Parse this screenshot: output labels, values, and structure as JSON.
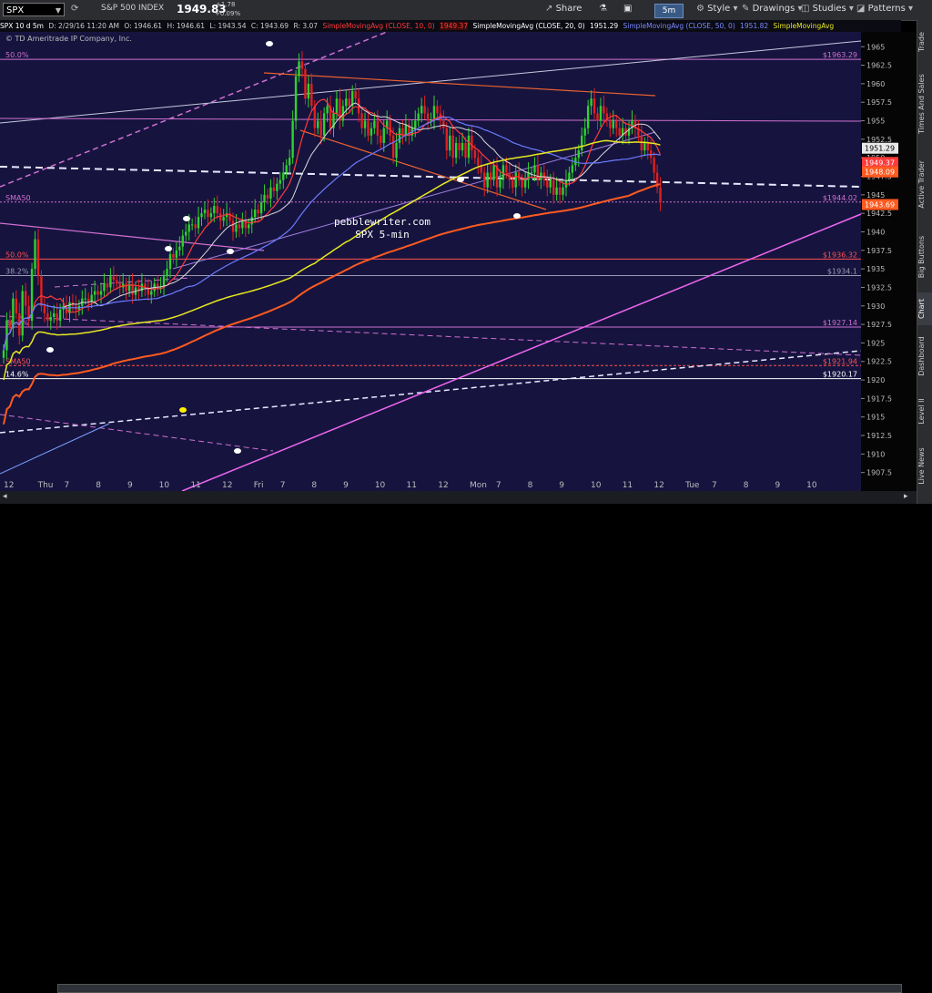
{
  "toolbar": {
    "symbol": "SPX",
    "name": "S&P 500 INDEX",
    "price": "1949.83",
    "change": "+1.78",
    "change_pct": "+0.09%",
    "share": "Share",
    "timeframe": "5m",
    "style": "Style",
    "drawings": "Drawings",
    "studies": "Studies",
    "patterns": "Patterns"
  },
  "info": {
    "desc": "SPX 10 d 5m",
    "date": "D: 2/29/16 11:20 AM",
    "open": "O: 1946.61",
    "high": "H: 1946.61",
    "low": "L: 1943.54",
    "close": "C: 1943.69",
    "range": "R: 3.07",
    "sma10_label": "SimpleMovingAvg (CLOSE, 10, 0)",
    "sma10_val": "1949.37",
    "sma20_label": "SimpleMovingAvg (CLOSE, 20, 0)",
    "sma20_val": "1951.29",
    "sma50_label": "SimpleMovingAvg (CLOSE, 50, 0)",
    "sma50_val": "1951.82",
    "sma_more": "SimpleMovingAvg",
    "copyright": "© TD Ameritrade IP Company, Inc."
  },
  "colors": {
    "bg": "#16143e",
    "up": "#2fd12f",
    "down": "#e02020",
    "sma10": "#ff3a3a",
    "sma20": "#d8d8d8",
    "sma50": "#6a7bff",
    "sma100": "#e8e820",
    "sma200": "#ff5a20",
    "fib": "#d070d0"
  },
  "watermark": {
    "line1": "pebblewriter.com",
    "line2": "SPX 5-min"
  },
  "side_tabs": [
    "Trade",
    "Times And Sales",
    "Active Trader",
    "Big Buttons",
    "Chart",
    "Dashboard",
    "Level II",
    "Live News"
  ],
  "level_labels": [
    {
      "name": "fib-top",
      "text": "50.0%",
      "price": 1963.29,
      "tag": "$1963.29",
      "color": "#d070d0"
    },
    {
      "name": "sma50-tag",
      "text": "SMA50",
      "price": 1944.02,
      "tag": "$1944.02",
      "color": "#d070d0"
    },
    {
      "name": "fib-50",
      "text": "50.0%",
      "price": 1936.32,
      "tag": "$1936.32",
      "color": "#ff5050"
    },
    {
      "name": "fib-382",
      "text": "38.2%",
      "price": 1934.1,
      "tag": "$1934.1",
      "color": "#9a9ab0"
    },
    {
      "name": "fib-382b",
      "text": "38.2%",
      "price": 1927.14,
      "tag": "$1927.14",
      "color": "#d070d0"
    },
    {
      "name": "sma-red",
      "text": "SMA50",
      "price": 1921.94,
      "tag": "$1921.94",
      "color": "#ff5050"
    },
    {
      "name": "fib-146",
      "text": "14.6%",
      "price": 1920.17,
      "tag": "$1920.17",
      "color": "#ffffff"
    }
  ],
  "chart_data": {
    "type": "candlestick",
    "y_range": [
      1905,
      1967
    ],
    "y_ticks": [
      1965,
      1962.5,
      1960,
      1957.5,
      1955,
      1952.5,
      1950,
      1947.5,
      1945,
      1942.5,
      1940,
      1937.5,
      1935,
      1932.5,
      1930,
      1927.5,
      1925,
      1922.5,
      1920,
      1917.5,
      1915,
      1912.5,
      1910,
      1907.5
    ],
    "price_tags": [
      {
        "value": 1951.29,
        "label": "1951.29",
        "bg": "#e8e8e8",
        "fg": "#000"
      },
      {
        "value": 1949.37,
        "label": "1949.37",
        "bg": "#ff3a3a",
        "fg": "#fff"
      },
      {
        "value": 1948.09,
        "label": "1948.09",
        "bg": "#ff5a20",
        "fg": "#fff"
      },
      {
        "value": 1943.69,
        "label": "1943.69",
        "bg": "#ff5a20",
        "fg": "#fff"
      }
    ],
    "x_labels": [
      {
        "i": 0,
        "t": "12"
      },
      {
        "i": 13,
        "t": "Thu"
      },
      {
        "i": 23,
        "t": "7"
      },
      {
        "i": 35,
        "t": "8"
      },
      {
        "i": 47,
        "t": "9"
      },
      {
        "i": 59,
        "t": "10"
      },
      {
        "i": 71,
        "t": "11"
      },
      {
        "i": 83,
        "t": "12"
      },
      {
        "i": 95,
        "t": "Fri"
      },
      {
        "i": 105,
        "t": "7"
      },
      {
        "i": 117,
        "t": "8"
      },
      {
        "i": 129,
        "t": "9"
      },
      {
        "i": 141,
        "t": "10"
      },
      {
        "i": 153,
        "t": "11"
      },
      {
        "i": 165,
        "t": "12"
      },
      {
        "i": 177,
        "t": "Mon"
      },
      {
        "i": 187,
        "t": "7"
      },
      {
        "i": 199,
        "t": "8"
      },
      {
        "i": 211,
        "t": "9"
      },
      {
        "i": 223,
        "t": "10"
      },
      {
        "i": 235,
        "t": "11"
      },
      {
        "i": 247,
        "t": "12"
      },
      {
        "i": 259,
        "t": "Tue"
      },
      {
        "i": 269,
        "t": "7"
      },
      {
        "i": 281,
        "t": "8"
      },
      {
        "i": 293,
        "t": "9"
      },
      {
        "i": 305,
        "t": "10"
      }
    ],
    "n_slots": 325,
    "closes": [
      1924,
      1928,
      1927,
      1931,
      1929,
      1926,
      1932,
      1930,
      1928,
      1935,
      1939,
      1934,
      1930,
      1929,
      1928,
      1928.5,
      1929,
      1928,
      1929.5,
      1930,
      1929,
      1930.5,
      1930,
      1929.5,
      1930,
      1931,
      1931,
      1930.5,
      1931.5,
      1932,
      1931.5,
      1932,
      1933,
      1932.5,
      1934,
      1933.5,
      1933,
      1932.5,
      1933,
      1932,
      1933,
      1931.5,
      1932.5,
      1932,
      1933,
      1932.5,
      1931.5,
      1932,
      1933,
      1932.5,
      1932.5,
      1934,
      1935,
      1937,
      1936.5,
      1937.5,
      1938,
      1939.5,
      1940,
      1941,
      1941,
      1940.5,
      1942,
      1942.5,
      1943,
      1942,
      1942.5,
      1943.5,
      1942.5,
      1941.5,
      1942,
      1942.5,
      1941.5,
      1940,
      1941,
      1940.5,
      1941.5,
      1940.5,
      1941,
      1942,
      1943,
      1942.5,
      1944,
      1945,
      1944.5,
      1946,
      1945.5,
      1946.5,
      1947,
      1948,
      1949,
      1950,
      1955,
      1961,
      1963,
      1962,
      1958,
      1960,
      1957,
      1954,
      1955,
      1953,
      1956,
      1957,
      1954,
      1956,
      1958,
      1955,
      1957,
      1958,
      1957,
      1959,
      1958,
      1956,
      1954,
      1955,
      1953,
      1954,
      1955,
      1953,
      1952,
      1954,
      1955,
      1953,
      1950,
      1952,
      1954,
      1953,
      1954.5,
      1953,
      1954,
      1955,
      1956,
      1957,
      1956,
      1955,
      1955,
      1957,
      1956,
      1955,
      1954,
      1951,
      1953,
      1950,
      1952,
      1951,
      1952,
      1950,
      1953,
      1951,
      1950,
      1949,
      1948,
      1946,
      1948,
      1947,
      1949,
      1946,
      1947,
      1949,
      1948,
      1947,
      1946,
      1948,
      1947,
      1946,
      1947,
      1948,
      1948,
      1949,
      1947,
      1948,
      1947,
      1946,
      1947,
      1945,
      1946,
      1945,
      1946,
      1947,
      1948,
      1949,
      1950,
      1951,
      1953,
      1954,
      1957,
      1958,
      1956,
      1955,
      1957,
      1956,
      1955,
      1954,
      1955,
      1954,
      1953,
      1954,
      1953,
      1954,
      1955,
      1954,
      1953,
      1951,
      1952,
      1951,
      1950,
      1948,
      1946,
      1944
    ]
  }
}
